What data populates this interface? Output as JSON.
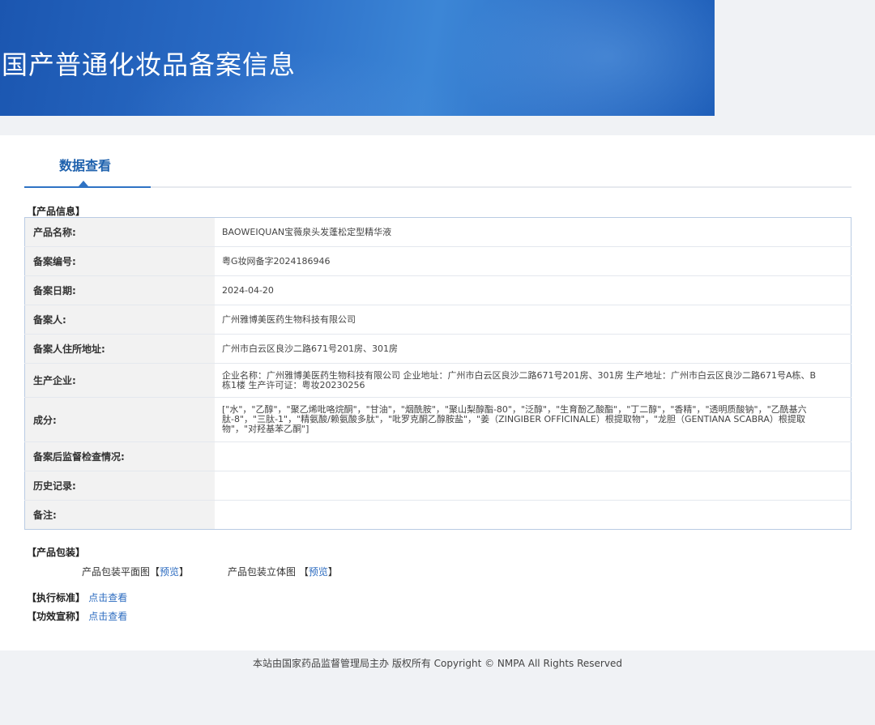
{
  "banner": {
    "title": "国产普通化妆品备案信息"
  },
  "tab": {
    "label": "数据查看"
  },
  "product_info": {
    "section_title": "【产品信息】",
    "rows": [
      {
        "label": "产品名称:",
        "value": "BAOWEIQUAN宝薇泉头发蓬松定型精华液"
      },
      {
        "label": "备案编号:",
        "value": "粤G妆网备字2024186946"
      },
      {
        "label": "备案日期:",
        "value": "2024-04-20"
      },
      {
        "label": "备案人:",
        "value": "广州雅博美医药生物科技有限公司"
      },
      {
        "label": "备案人住所地址:",
        "value": "广州市白云区良沙二路671号201房、301房"
      },
      {
        "label": "生产企业:",
        "value": "企业名称：广州雅博美医药生物科技有限公司 企业地址：广州市白云区良沙二路671号201房、301房 生产地址：广州市白云区良沙二路671号A栋、B栋1楼 生产许可证：粤妆20230256"
      },
      {
        "label": "成分:",
        "value": "[\"水\"，\"乙醇\"，\"聚乙烯吡咯烷酮\"，\"甘油\"，\"烟酰胺\"，\"聚山梨醇酯-80\"，\"泛醇\"，\"生育酚乙酸酯\"，\"丁二醇\"，\"香精\"，\"透明质酸钠\"，\"乙酰基六肽-8\"，\"三肽-1\"，\"精氨酸/赖氨酸多肽\"，\"吡罗克酮乙醇胺盐\"，\"姜（ZINGIBER OFFICINALE）根提取物\"，\"龙胆（GENTIANA SCABRA）根提取物\"，\"对羟基苯乙酮\"]"
      },
      {
        "label": "备案后监督检查情况:",
        "value": ""
      },
      {
        "label": "历史记录:",
        "value": ""
      },
      {
        "label": "备注:",
        "value": ""
      }
    ]
  },
  "packaging": {
    "section_title": "【产品包装】",
    "flat_label": "产品包装平面图",
    "flat_link": "预览",
    "solid_label": "产品包装立体图",
    "solid_link": "预览"
  },
  "standard": {
    "label": "【执行标准】",
    "link": "点击查看"
  },
  "efficacy": {
    "label": "【功效宣称】",
    "link": "点击查看"
  },
  "footer": {
    "text": "本站由国家药品监督管理局主办 版权所有 Copyright © NMPA All Rights Reserved"
  }
}
